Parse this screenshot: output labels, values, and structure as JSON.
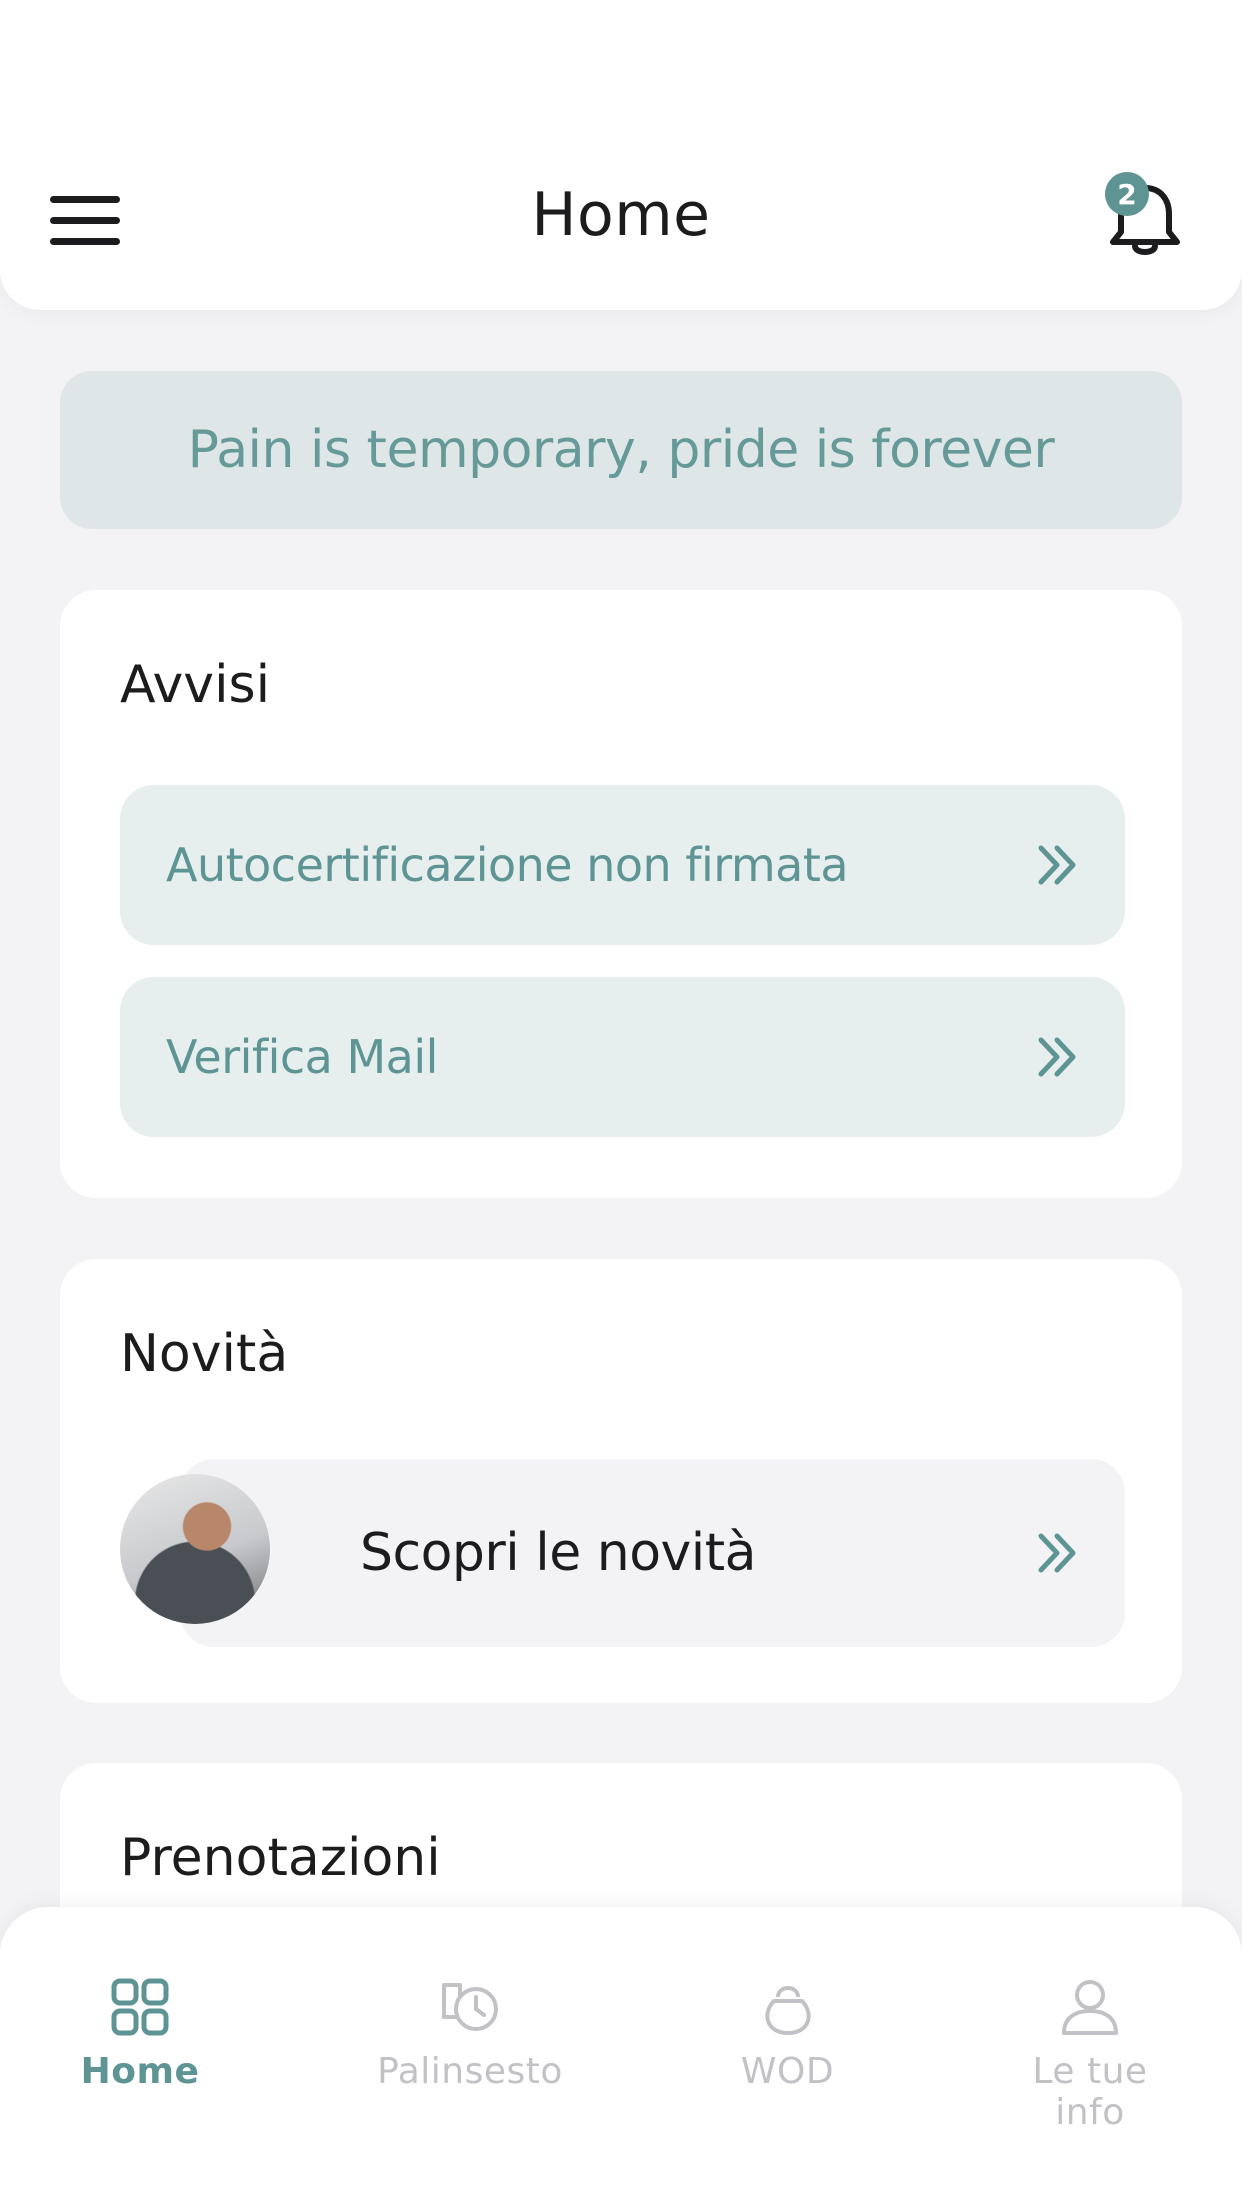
{
  "header": {
    "title": "Home",
    "notification_count": "2"
  },
  "quote": "Pain is temporary, pride is forever",
  "alerts": {
    "title": "Avvisi",
    "items": [
      {
        "label": "Autocertificazione non firmata"
      },
      {
        "label": "Verifica Mail"
      }
    ]
  },
  "news": {
    "title": "Novità",
    "item_label": "Scopri le novità"
  },
  "bookings": {
    "title": "Prenotazioni"
  },
  "nav": {
    "items": [
      {
        "label": "Home",
        "icon": "grid-icon",
        "active": true
      },
      {
        "label": "Palinsesto",
        "icon": "schedule-icon",
        "active": false
      },
      {
        "label": "WOD",
        "icon": "kettlebell-icon",
        "active": false
      },
      {
        "label": "Le tue info",
        "icon": "user-icon",
        "active": false
      }
    ]
  },
  "colors": {
    "accent": "#5e9594",
    "background": "#f3f3f5",
    "quote_bg": "#dfe6e7",
    "alert_bg": "#e6eeee"
  }
}
